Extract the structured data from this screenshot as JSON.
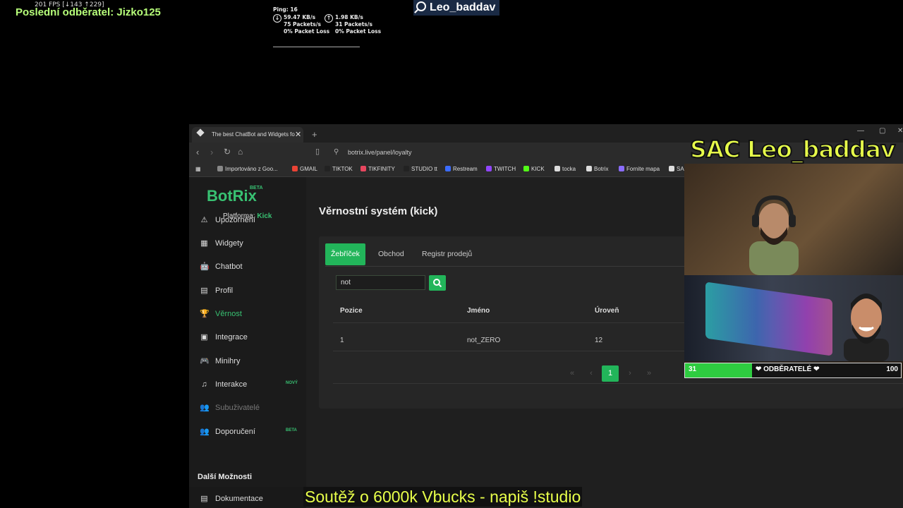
{
  "overlay": {
    "fps": "201 FPS [↓143 ↑229]",
    "last_subscriber": "Poslední odběratel: Jizko125",
    "ping": "Ping: 16",
    "down": {
      "rate": "59.47 KB/s",
      "packets": "75 Packets/s",
      "loss": "0% Packet Loss"
    },
    "up": {
      "rate": "1.98 KB/s",
      "packets": "31 Packets/s",
      "loss": "0% Packet Loss"
    },
    "streamer_tag": "Leo_baddav",
    "cam_title": "SAC Leo_baddav",
    "sub_goal": {
      "current": "31",
      "label": "❤ ODBĚRATELÉ ❤",
      "max": "100",
      "progress": 0.31
    },
    "giveaway": "Soutěž o 6000k Vbucks - napiš !studio"
  },
  "browser": {
    "tab_title": "The best ChatBot and Widgets fo",
    "url": "botrix.live/panel/loyalty",
    "bookmarks": [
      {
        "label": "Importováno z Goo...",
        "color": "#888"
      },
      {
        "label": "GMAIL",
        "color": "#ea4335"
      },
      {
        "label": "TIKTOK",
        "color": "#222"
      },
      {
        "label": "TIKFINITY",
        "color": "#e8475f"
      },
      {
        "label": "STUDIO tt",
        "color": "#222"
      },
      {
        "label": "Restream",
        "color": "#3b6cff"
      },
      {
        "label": "TWITCH",
        "color": "#9146ff"
      },
      {
        "label": "KICK",
        "color": "#53fc18"
      },
      {
        "label": "tocka",
        "color": "#ddd"
      },
      {
        "label": "Botrix",
        "color": "#ddd"
      },
      {
        "label": "Fornite mapa",
        "color": "#8a6cff"
      },
      {
        "label": "SA",
        "color": "#ddd"
      }
    ]
  },
  "app": {
    "logo": "BotRix",
    "logo_badge": "BETA",
    "platform_label": "Platforma:",
    "platform_value": "Kick",
    "menu": [
      {
        "label": "Upozornění",
        "icon": "⚠"
      },
      {
        "label": "Widgety",
        "icon": "▦"
      },
      {
        "label": "Chatbot",
        "icon": "🤖"
      },
      {
        "label": "Profil",
        "icon": "▤"
      },
      {
        "label": "Věrnost",
        "icon": "🏆"
      },
      {
        "label": "Integrace",
        "icon": "▣"
      },
      {
        "label": "Minihry",
        "icon": "🎮"
      },
      {
        "label": "Interakce",
        "icon": "♫",
        "badge": "NOVÝ"
      },
      {
        "label": "Subuživatelé",
        "icon": "👥"
      },
      {
        "label": "Doporučení",
        "icon": "👥",
        "badge": "BETA"
      }
    ],
    "section_title": "Další Možnosti",
    "doc_item": "Dokumentace",
    "page_title": "Věrnostní systém (kick)",
    "tabs": [
      "Žebříček",
      "Obchod",
      "Registr prodejů"
    ],
    "search_value": "not",
    "table": {
      "headers": [
        "Pozice",
        "Jméno",
        "Úroveň"
      ],
      "rows": [
        [
          "1",
          "not_ZERO",
          "12"
        ]
      ]
    },
    "pagination": {
      "first": "«",
      "prev": "‹",
      "current": "1",
      "next": "›",
      "last": "»"
    }
  }
}
